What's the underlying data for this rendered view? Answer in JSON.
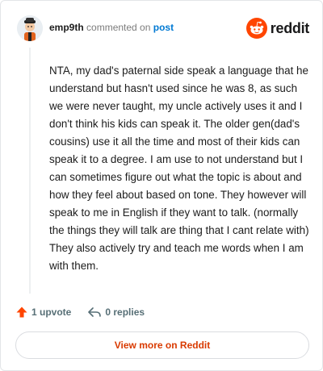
{
  "header": {
    "username": "emp9th",
    "action": "commented on",
    "post_link": "post",
    "brand": "reddit"
  },
  "comment": {
    "body": "NTA, my dad's paternal side speak a language that he understand but hasn't used since he was 8, as such we were never taught, my uncle actively uses it and I don't think his kids can speak it. The older gen(dad's cousins) use it all the time and most of their kids can speak it to a degree. I am use to not understand but I can sometimes figure out what the topic is about and how they feel about based on tone. They however will speak to me in English if they want to talk. (normally the things they will talk are thing that I cant relate with) They also actively try and teach me words when I am with them."
  },
  "actions": {
    "upvotes": "1 upvote",
    "replies": "0 replies",
    "upvote_icon": "upvote-arrow-icon",
    "reply_icon": "reply-arrow-icon"
  },
  "footer": {
    "view_more": "View more on Reddit"
  },
  "colors": {
    "brand_orange": "#ff4500",
    "upvote_orange": "#ff4500",
    "link_blue": "#0079d3",
    "button_text": "#d93a00"
  }
}
